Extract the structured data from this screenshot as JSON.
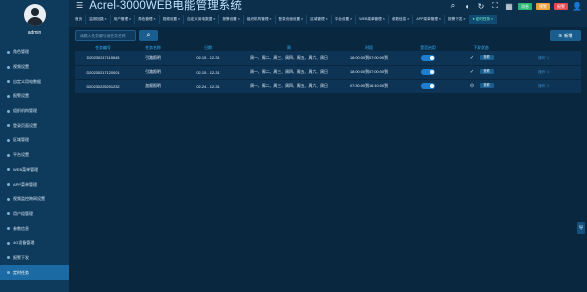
{
  "user": {
    "name": "admin"
  },
  "header": {
    "title": "Acrel-3000WEB电能管理系统",
    "badges": [
      {
        "label": "消息",
        "color": "#2bb673"
      },
      {
        "label": "预警",
        "color": "#e6a23c"
      },
      {
        "label": "报警",
        "color": "#e5484d"
      }
    ],
    "tabs": [
      {
        "label": "首页"
      },
      {
        "label": "监测回路 ×"
      },
      {
        "label": "用户管理 ×"
      },
      {
        "label": "角色管理 ×"
      },
      {
        "label": "视频设置 ×"
      },
      {
        "label": "自定义用电数据 ×"
      },
      {
        "label": "报警设置 ×"
      },
      {
        "label": "组织机构管理 ×"
      },
      {
        "label": "登录页面设置 ×"
      },
      {
        "label": "区域管理 ×"
      },
      {
        "label": "平台设置 ×"
      },
      {
        "label": "WEB菜单管理 ×"
      },
      {
        "label": "参数信息 ×"
      },
      {
        "label": "APP菜单管理 ×"
      },
      {
        "label": "报警下发 ×"
      },
      {
        "label": "● 定时任务 ×"
      }
    ]
  },
  "sidebar": {
    "items": [
      {
        "label": "角色管理"
      },
      {
        "label": "视频设置"
      },
      {
        "label": "自定义用电数据"
      },
      {
        "label": "报警设置"
      },
      {
        "label": "组织机构管理"
      },
      {
        "label": "登录页面设置"
      },
      {
        "label": "区域管理"
      },
      {
        "label": "平台设置"
      },
      {
        "label": "WEB菜单管理"
      },
      {
        "label": "APP菜单管理"
      },
      {
        "label": "视频监控跨网设置"
      },
      {
        "label": "用户组管理"
      },
      {
        "label": "参数信息"
      },
      {
        "label": "4G设备管理"
      },
      {
        "label": "报警下发"
      },
      {
        "label": "定时任务"
      }
    ]
  },
  "toolbar": {
    "search_placeholder": "请输入任务编号或任务名称",
    "add_label": "新增"
  },
  "table": {
    "headers": [
      "任务编号",
      "任务名称",
      "日期",
      "周",
      "时段",
      "是否启用",
      "下发状态",
      ""
    ],
    "rows": [
      {
        "id": "D20230217115545",
        "name": "引路照明",
        "date": "02-15 - 12-31",
        "week": "周一、周二、周三、周四、周五、周六、周日",
        "time": "18:00:00到07:00:00到",
        "status_mark": "✓",
        "action": "查看",
        "op": "操作 ∨"
      },
      {
        "id": "D20230217120001",
        "name": "引路照明",
        "date": "02-15 - 12-31",
        "week": "周一、周二、周三、周四、周五、周六、周日",
        "time": "18:00:00到07:00:00到",
        "status_mark": "✓",
        "action": "查看",
        "op": "操作 ∨"
      },
      {
        "id": "D20230225201232",
        "name": "加顾照明",
        "date": "02-24 - 12-31",
        "week": "周一、周二、周三、周四、周五、周六、周日",
        "time": "07:30:00到16:10:00到",
        "status_mark": "⊙",
        "action": "查看",
        "op": "操作 ∨"
      }
    ]
  },
  "float_label": "导"
}
